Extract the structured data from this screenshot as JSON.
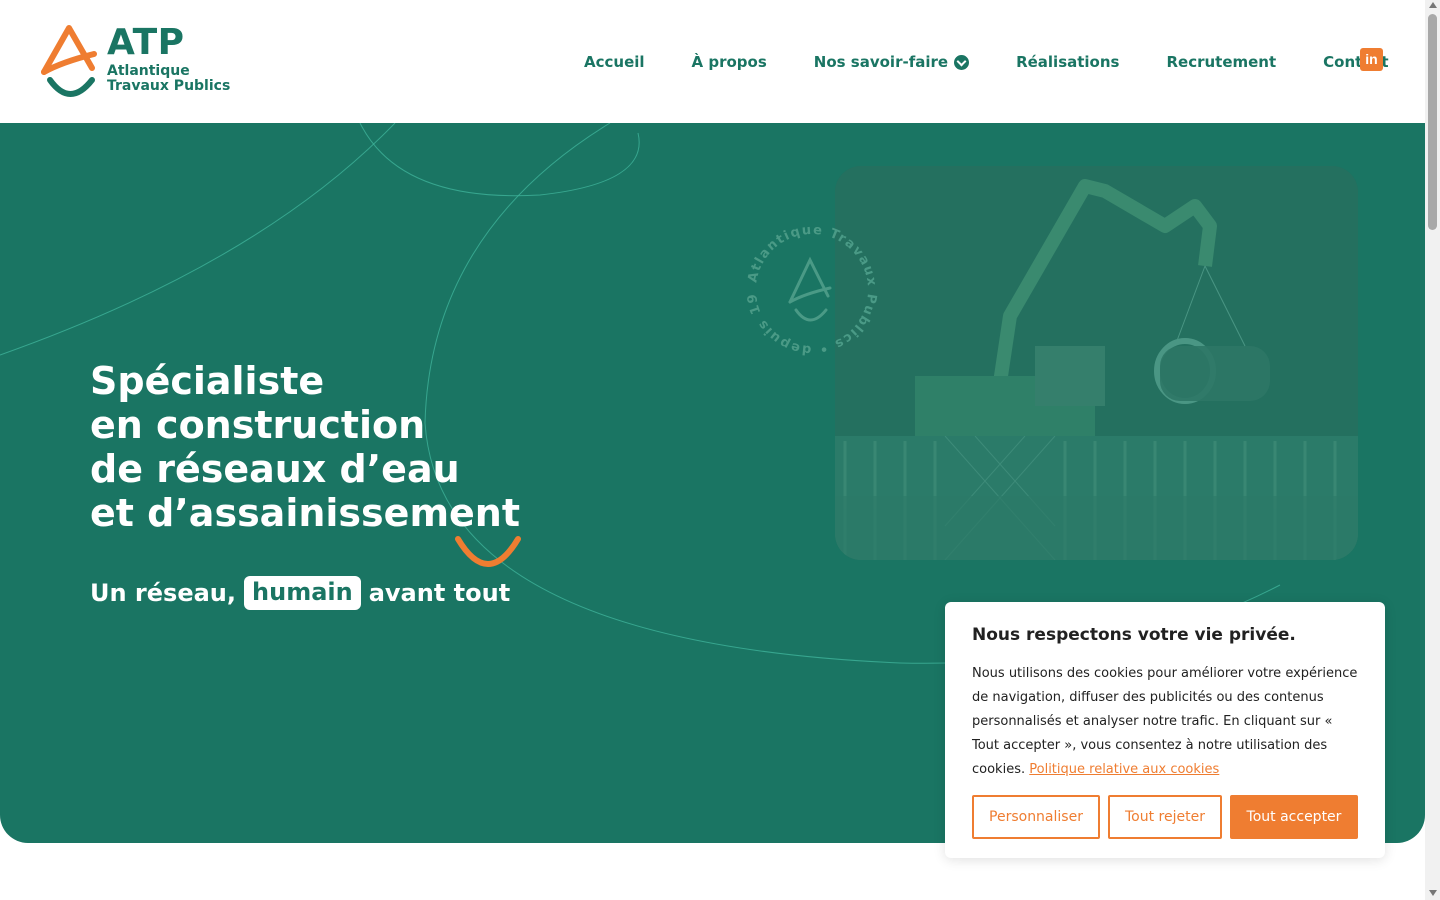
{
  "brand": {
    "abbr": "ATP",
    "line1": "Atlantique",
    "line2": "Travaux Publics",
    "green": "#1a7563",
    "orange": "#ef7d31"
  },
  "nav": {
    "items": [
      {
        "label": "Accueil"
      },
      {
        "label": "À propos"
      },
      {
        "label": "Nos savoir-faire"
      },
      {
        "label": "Réalisations"
      },
      {
        "label": "Recrutement"
      },
      {
        "label": "Contact"
      }
    ],
    "social_icon": "linkedin-icon",
    "social_text": "in"
  },
  "hero": {
    "title_lines": [
      "Spécialiste",
      "en construction",
      "de réseaux d’eau",
      "et d’assainissement"
    ],
    "sub_before": "Un réseau,",
    "sub_highlight": "humain",
    "sub_after": "avant tout",
    "badge_text": "Atlantique Travaux Publics • depuis 1980 •"
  },
  "cookie": {
    "title": "Nous respectons votre vie privée.",
    "body": "Nous utilisons des cookies pour améliorer votre expérience de navigation, diffuser des publicités ou des contenus personnalisés et analyser notre trafic. En cliquant sur « Tout accepter », vous consentez à notre utilisation des cookies.",
    "policy_link": "Politique relative aux cookies",
    "btn_customize": "Personnaliser",
    "btn_reject": "Tout rejeter",
    "btn_accept": "Tout accepter"
  }
}
